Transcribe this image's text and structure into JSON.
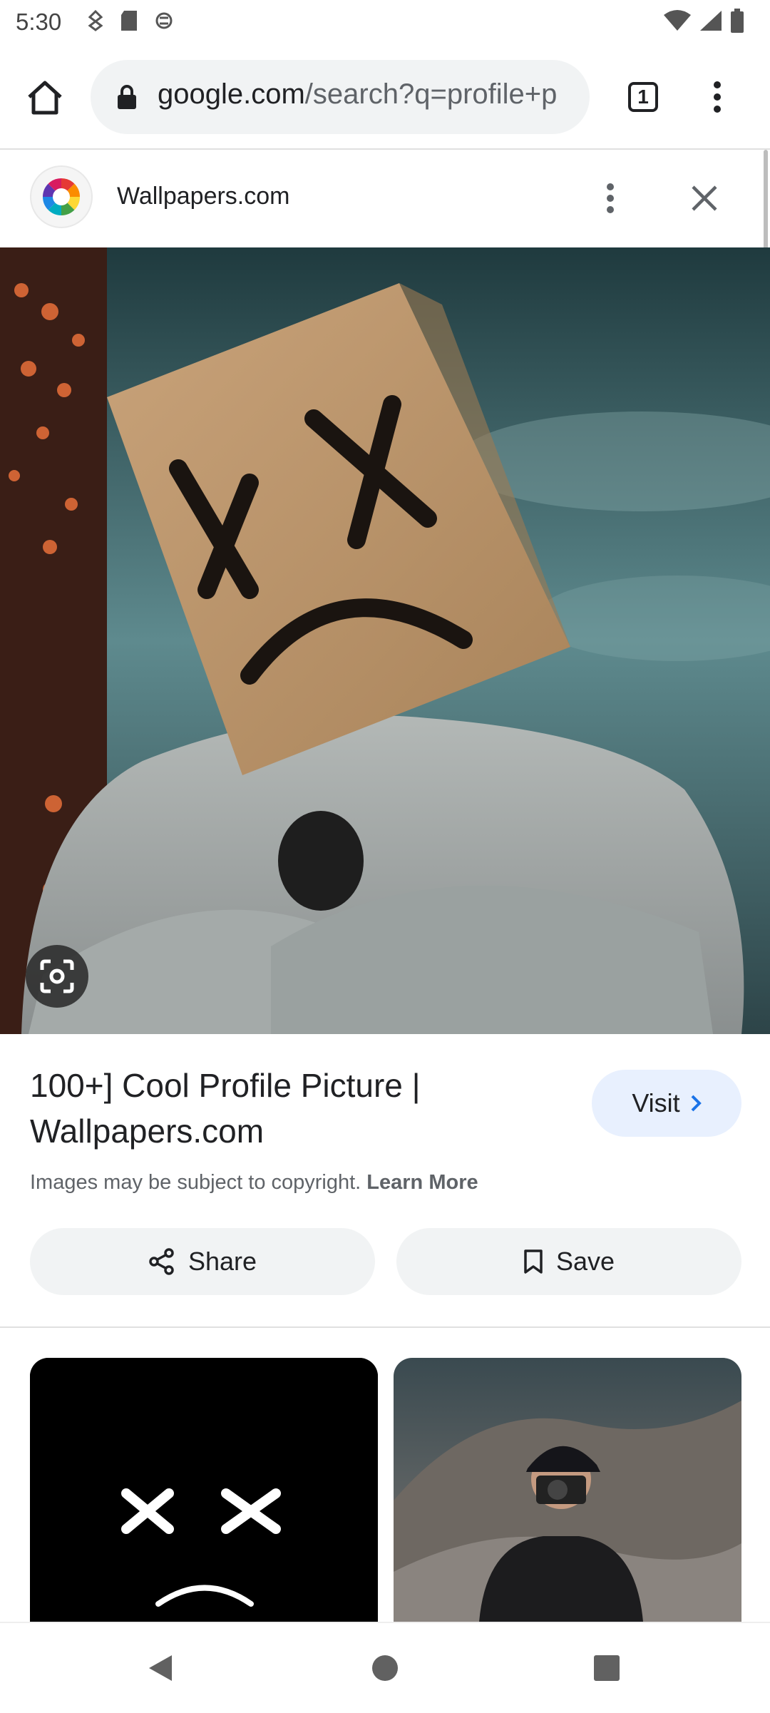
{
  "status_bar": {
    "time": "5:30"
  },
  "browser": {
    "url_domain": "google.com",
    "url_path": "/search?q=profile+p",
    "tab_count": "1"
  },
  "source": {
    "name": "Wallpapers.com"
  },
  "result": {
    "title": "100+] Cool Profile Picture | Wallpapers.com",
    "visit_label": "Visit",
    "copyright_text": "Images may be subject to copyright.",
    "learn_more_label": "Learn More",
    "share_label": "Share",
    "save_label": "Save"
  },
  "colors": {
    "accent": "#1a73e8",
    "visit_bg": "#e8f0fe",
    "button_bg": "#f1f3f4"
  }
}
